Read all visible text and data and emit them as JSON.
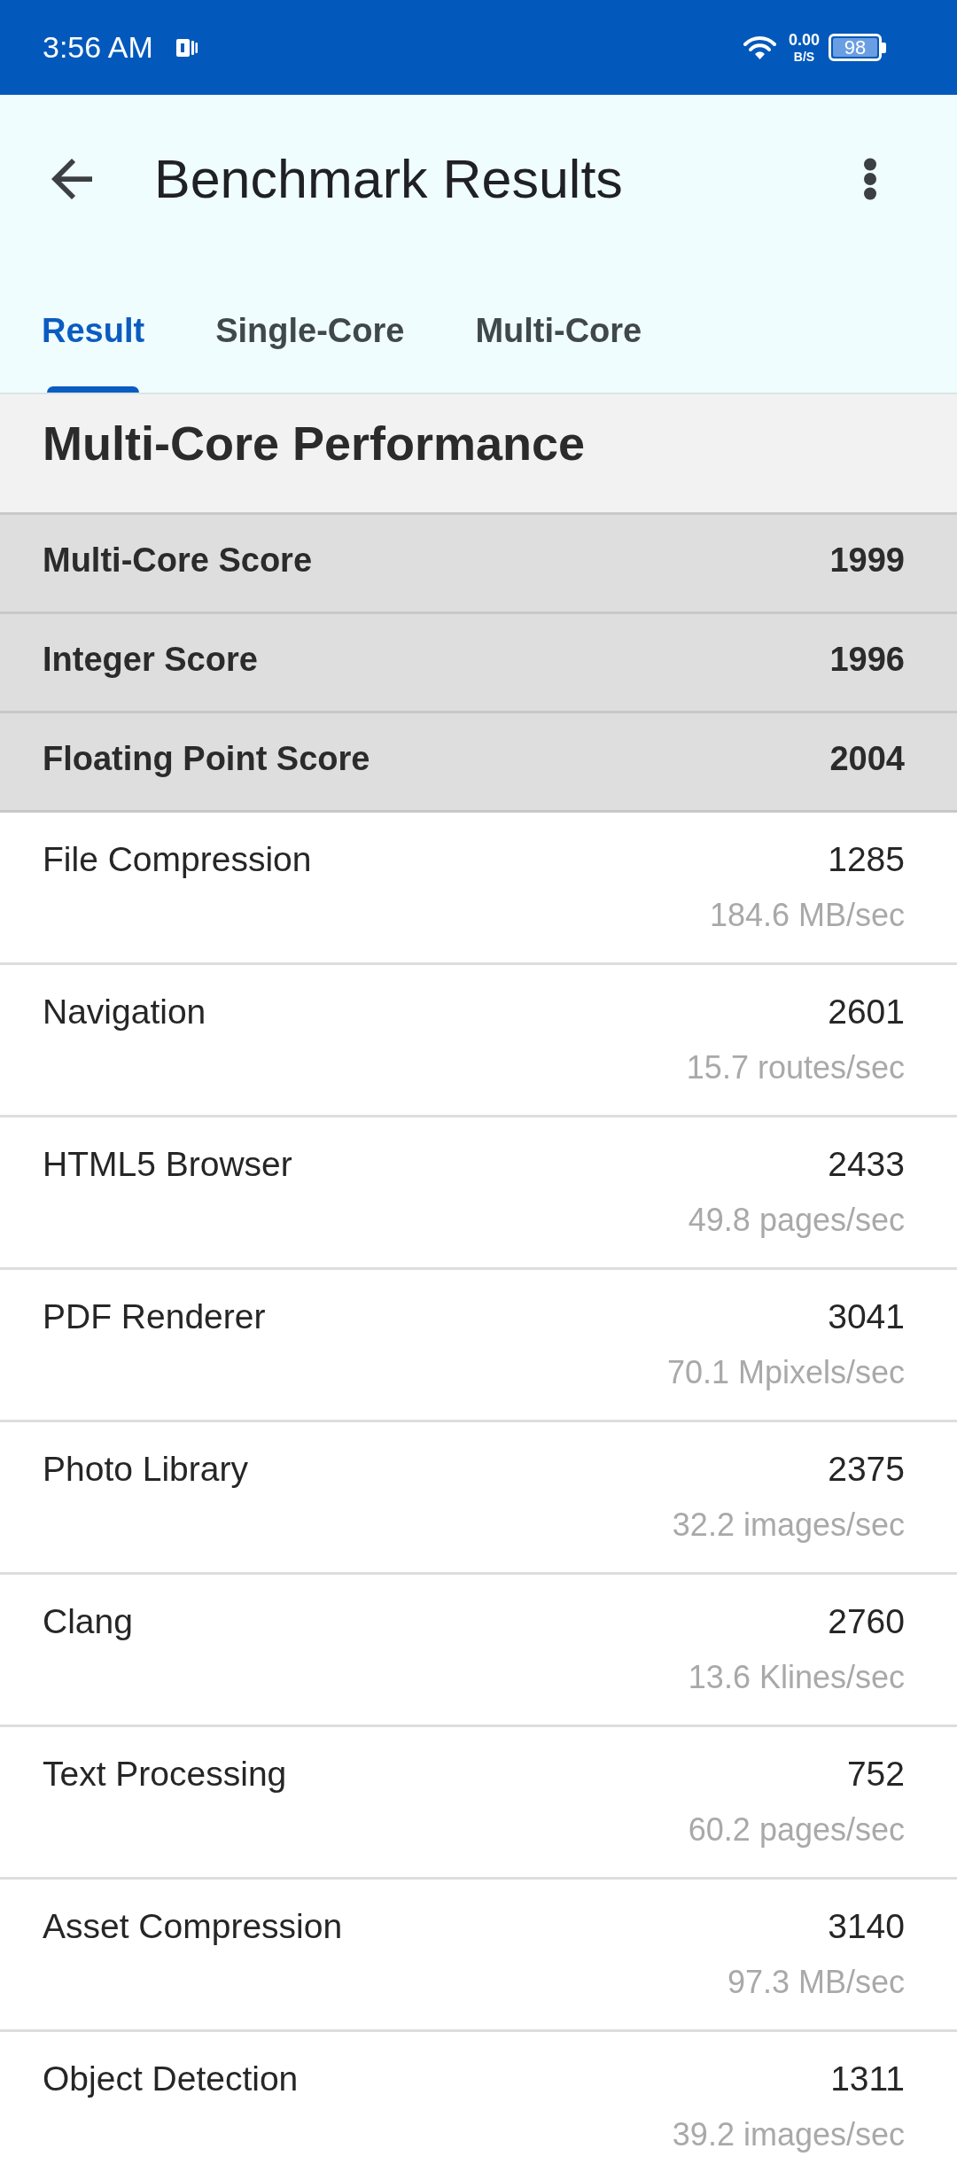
{
  "status_bar": {
    "time": "3:56 AM",
    "network_speed": "0.00",
    "network_speed_unit": "B/S",
    "battery": "98"
  },
  "app_bar": {
    "title": "Benchmark Results"
  },
  "tabs": [
    {
      "label": "Result",
      "selected": true
    },
    {
      "label": "Single-Core",
      "selected": false
    },
    {
      "label": "Multi-Core",
      "selected": false
    }
  ],
  "section": {
    "title": "Multi-Core Performance",
    "summary_scores": [
      {
        "label": "Multi-Core Score",
        "score": "1999"
      },
      {
        "label": "Integer Score",
        "score": "1996"
      },
      {
        "label": "Floating Point Score",
        "score": "2004"
      }
    ],
    "benchmarks": [
      {
        "name": "File Compression",
        "score": "1285",
        "rate": "184.6 MB/sec"
      },
      {
        "name": "Navigation",
        "score": "2601",
        "rate": "15.7 routes/sec"
      },
      {
        "name": "HTML5 Browser",
        "score": "2433",
        "rate": "49.8 pages/sec"
      },
      {
        "name": "PDF Renderer",
        "score": "3041",
        "rate": "70.1 Mpixels/sec"
      },
      {
        "name": "Photo Library",
        "score": "2375",
        "rate": "32.2 images/sec"
      },
      {
        "name": "Clang",
        "score": "2760",
        "rate": "13.6 Klines/sec"
      },
      {
        "name": "Text Processing",
        "score": "752",
        "rate": "60.2 pages/sec"
      },
      {
        "name": "Asset Compression",
        "score": "3140",
        "rate": "97.3 MB/sec"
      },
      {
        "name": "Object Detection",
        "score": "1311",
        "rate": "39.2 images/sec"
      }
    ]
  }
}
